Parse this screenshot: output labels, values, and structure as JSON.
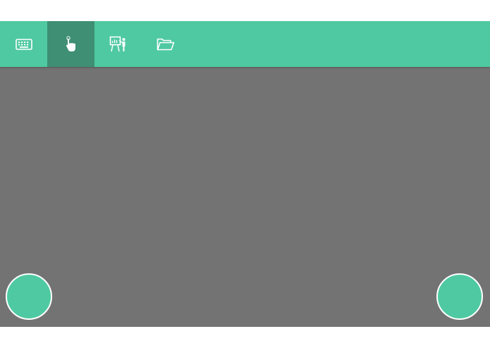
{
  "colors": {
    "accent": "#4fc9a1",
    "accent_active": "#3e8f73",
    "workspace": "#737373",
    "background": "#ffffff",
    "icon": "#ffffff"
  },
  "toolbar": {
    "tabs": [
      {
        "icon": "keyboard-icon",
        "active": false
      },
      {
        "icon": "touch-hand-icon",
        "active": true
      },
      {
        "icon": "presentation-icon",
        "active": false
      },
      {
        "icon": "folder-open-icon",
        "active": false
      }
    ]
  },
  "buttons": {
    "left": {
      "icon": "none"
    },
    "right": {
      "icon": "none"
    }
  }
}
